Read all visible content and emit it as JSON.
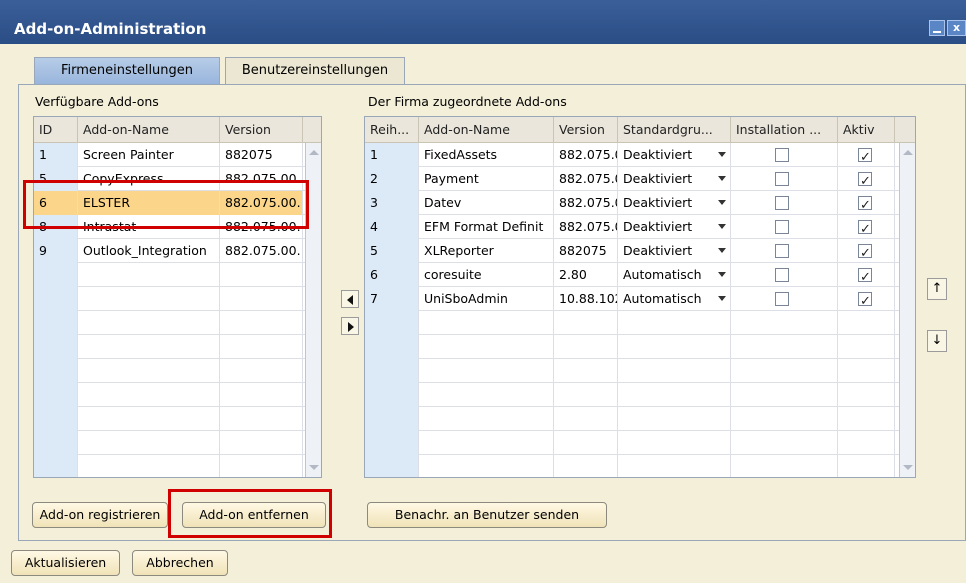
{
  "window": {
    "title": "Add-on-Administration"
  },
  "tabs": [
    {
      "label": "Firmeneinstellungen",
      "active": true
    },
    {
      "label": "Benutzereinstellungen",
      "active": false
    }
  ],
  "left": {
    "label": "Verfügbare Add-ons",
    "columns": [
      "ID",
      "Add-on-Name",
      "Version"
    ],
    "rows": [
      {
        "id": "1",
        "name": "Screen Painter",
        "version": "882075",
        "selected": false
      },
      {
        "id": "5",
        "name": "CopyExpress",
        "version": "882.075.00.",
        "selected": false
      },
      {
        "id": "6",
        "name": "ELSTER",
        "version": "882.075.00.",
        "selected": true
      },
      {
        "id": "8",
        "name": "Intrastat",
        "version": "882.075.00.",
        "selected": false
      },
      {
        "id": "9",
        "name": "Outlook_Integration",
        "version": "882.075.00.",
        "selected": false
      }
    ],
    "register_label": "Add-on registrieren",
    "remove_label": "Add-on entfernen"
  },
  "right": {
    "label": "Der Firma zugeordnete Add-ons",
    "columns": [
      "Reih...",
      "Add-on-Name",
      "Version",
      "Standardgru...",
      "Installation ...",
      "Aktiv"
    ],
    "rows": [
      {
        "order": "1",
        "name": "FixedAssets",
        "version": "882.075.0",
        "group": "Deaktiviert",
        "install": false,
        "active": true
      },
      {
        "order": "2",
        "name": "Payment",
        "version": "882.075.0",
        "group": "Deaktiviert",
        "install": false,
        "active": true
      },
      {
        "order": "3",
        "name": "Datev",
        "version": "882.075.0",
        "group": "Deaktiviert",
        "install": false,
        "active": true
      },
      {
        "order": "4",
        "name": "EFM Format Definit",
        "version": "882.075.0",
        "group": "Deaktiviert",
        "install": false,
        "active": true
      },
      {
        "order": "5",
        "name": "XLReporter",
        "version": "882075",
        "group": "Deaktiviert",
        "install": false,
        "active": true
      },
      {
        "order": "6",
        "name": "coresuite",
        "version": "2.80",
        "group": "Automatisch",
        "install": false,
        "active": true
      },
      {
        "order": "7",
        "name": "UniSboAdmin",
        "version": "10.88.102",
        "group": "Automatisch",
        "install": false,
        "active": true
      }
    ],
    "notify_label": "Benachr. an Benutzer senden"
  },
  "footer": {
    "update_label": "Aktualisieren",
    "cancel_label": "Abbrechen"
  },
  "icons": [
    "minimize-icon",
    "close-icon",
    "move-left-icon",
    "move-right-icon",
    "move-up-icon",
    "move-down-icon",
    "dropdown-arrow-icon",
    "checkbox-icon"
  ],
  "colors": {
    "titlebar": "#2a4d86",
    "selection": "#fad58a",
    "highlight": "#d10000"
  }
}
